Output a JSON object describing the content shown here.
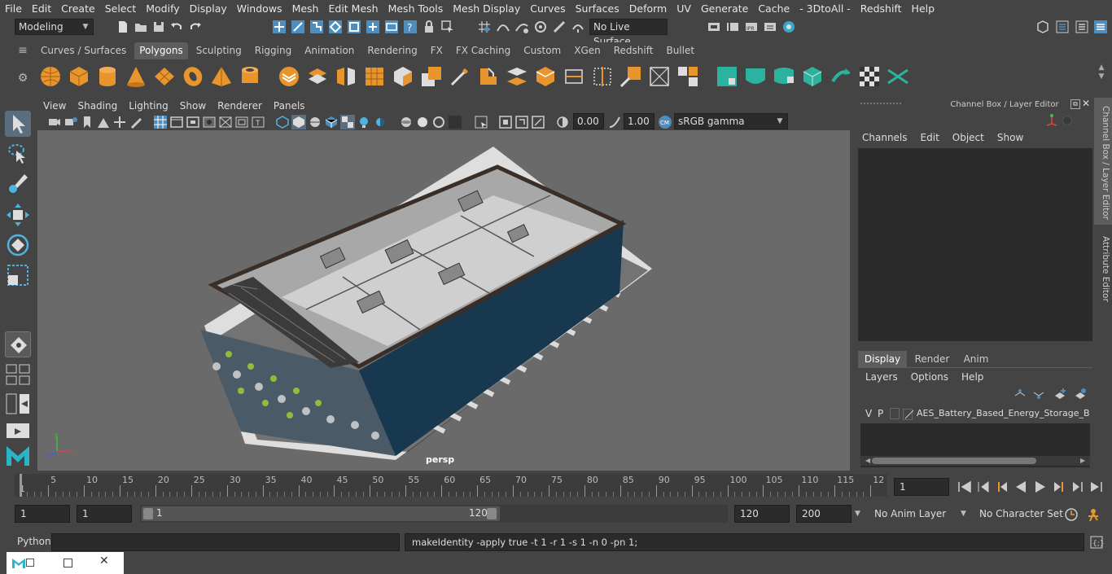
{
  "menubar": {
    "items": [
      "File",
      "Edit",
      "Create",
      "Select",
      "Modify",
      "Display",
      "Windows",
      "Mesh",
      "Edit Mesh",
      "Mesh Tools",
      "Mesh Display",
      "Curves",
      "Surfaces",
      "Deform",
      "UV",
      "Generate",
      "Cache",
      "- 3DtoAll -",
      "Redshift",
      "Help"
    ]
  },
  "statusline": {
    "mode": "Modeling",
    "live_surface": "No Live Surface"
  },
  "shelf": {
    "tabs": [
      "Curves / Surfaces",
      "Polygons",
      "Sculpting",
      "Rigging",
      "Animation",
      "Rendering",
      "FX",
      "FX Caching",
      "Custom",
      "XGen",
      "Redshift",
      "Bullet"
    ],
    "active_tab": "Polygons"
  },
  "viewport": {
    "menu": [
      "View",
      "Shading",
      "Lighting",
      "Show",
      "Renderer",
      "Panels"
    ],
    "exposure": "0.00",
    "gamma": "1.00",
    "color_space": "sRGB gamma",
    "camera_label": "persp"
  },
  "channelbox": {
    "title": "Channel Box / Layer Editor",
    "menu": [
      "Channels",
      "Edit",
      "Object",
      "Show"
    ],
    "layer_tabs": [
      "Display",
      "Render",
      "Anim"
    ],
    "active_layer_tab": "Display",
    "layer_menu": [
      "Layers",
      "Options",
      "Help"
    ],
    "layer": {
      "v": "V",
      "p": "P",
      "name": "AES_Battery_Based_Energy_Storage_Buildi"
    }
  },
  "side_tabs": {
    "channel": "Channel Box / Layer Editor",
    "attribute": "Attribute Editor"
  },
  "timeline": {
    "labels": [
      "5",
      "10",
      "15",
      "20",
      "25",
      "30",
      "35",
      "40",
      "45",
      "50",
      "55",
      "60",
      "65",
      "70",
      "75",
      "80",
      "85",
      "90",
      "95",
      "100",
      "105",
      "110",
      "115",
      "12"
    ],
    "current_marker": "1",
    "current_frame": "1"
  },
  "range": {
    "start": "1",
    "inner_start": "1",
    "slider_start": "1",
    "slider_end": "120",
    "end": "120",
    "outer_end": "200",
    "anim_layer": "No Anim Layer",
    "character_set": "No Character Set"
  },
  "cmdline": {
    "language": "Python",
    "output": "makeIdentity -apply true -t 1 -r 1 -s 1 -n 0 -pn 1;"
  },
  "colors": {
    "accent": "#4f8dbd",
    "shelf_orange": "#e8952e",
    "shelf_green": "#2bb3a0",
    "viewport_bg": "#6a6a6a"
  }
}
